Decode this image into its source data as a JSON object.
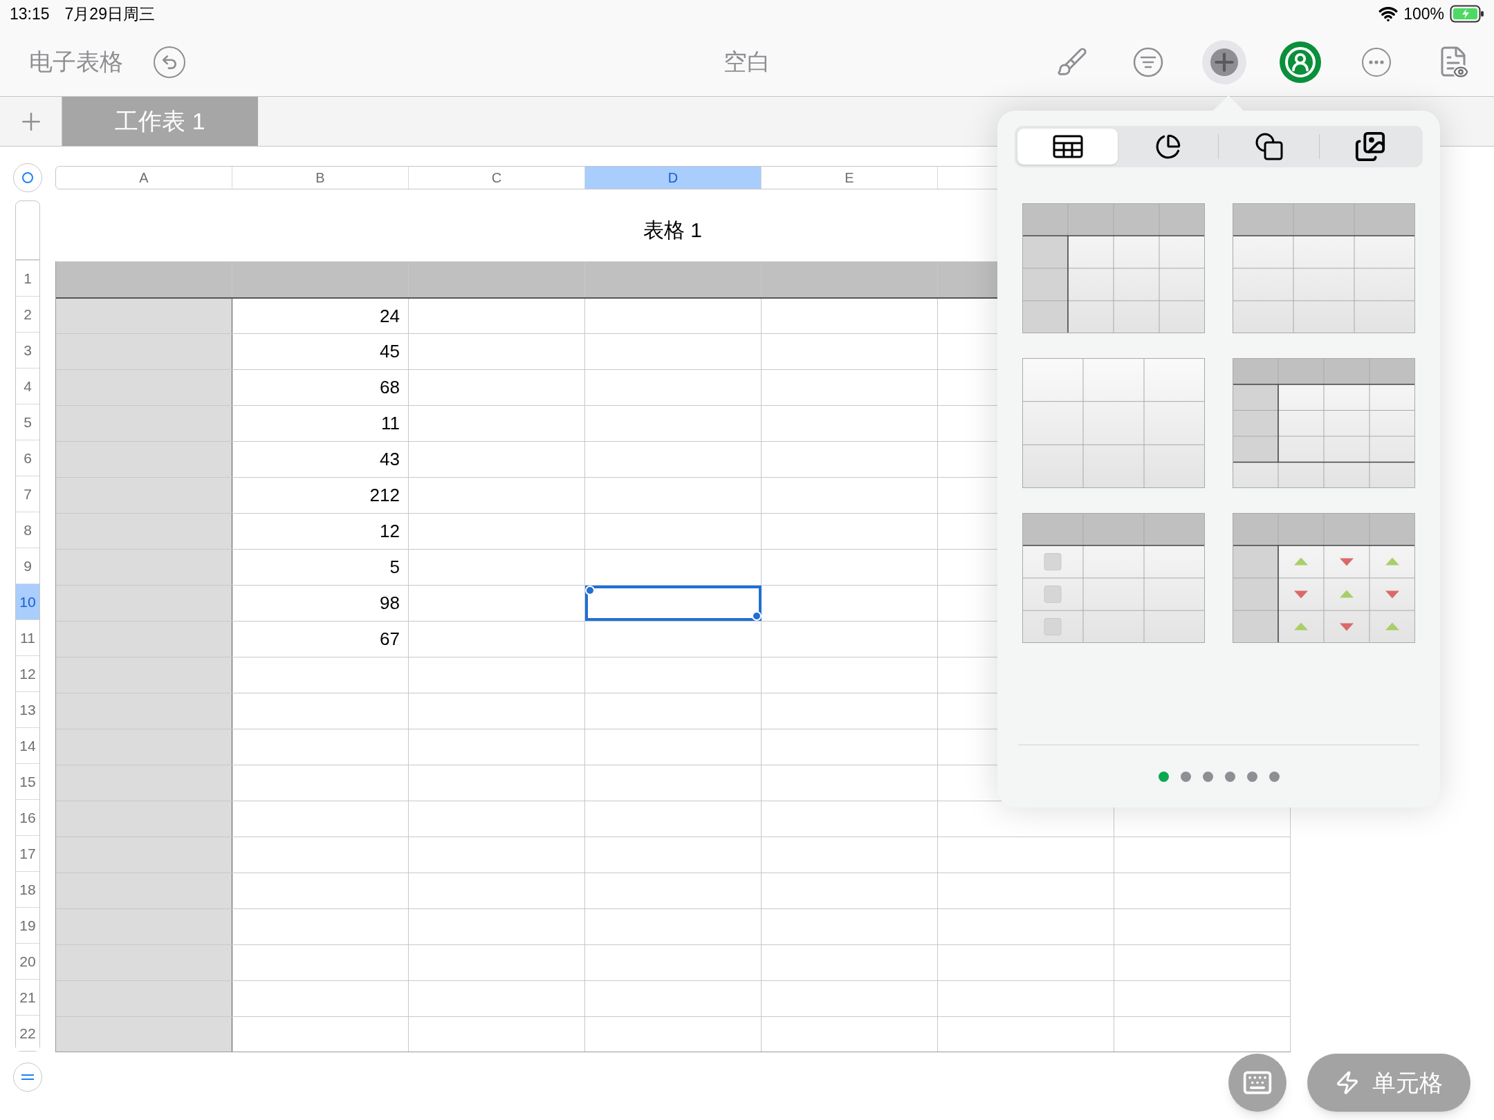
{
  "status_bar": {
    "time": "13:15",
    "date": "7月29日周三",
    "battery": "100%"
  },
  "toolbar": {
    "back_label": "电子表格",
    "title": "空白",
    "tools": [
      {
        "kind": "brush",
        "selected": false
      },
      {
        "kind": "filter",
        "selected": false
      },
      {
        "kind": "insert",
        "selected": true
      },
      {
        "kind": "collaborate",
        "selected": false
      },
      {
        "kind": "more",
        "selected": false
      },
      {
        "kind": "view",
        "selected": false
      }
    ]
  },
  "sheet_tabs": [
    {
      "label": "工作表 1",
      "selected": true
    }
  ],
  "column_headers": [
    {
      "label": "A",
      "selected": false
    },
    {
      "label": "B",
      "selected": false
    },
    {
      "label": "C",
      "selected": false
    },
    {
      "label": "D",
      "selected": true
    },
    {
      "label": "E",
      "selected": false
    }
  ],
  "table": {
    "title": "表格 1",
    "rows": [
      {
        "number": "1",
        "selected": false
      },
      {
        "number": "2",
        "selected": false,
        "column_b": "24"
      },
      {
        "number": "3",
        "selected": false,
        "column_b": "45"
      },
      {
        "number": "4",
        "selected": false,
        "column_b": "68"
      },
      {
        "number": "5",
        "selected": false,
        "column_b": "11"
      },
      {
        "number": "6",
        "selected": false,
        "column_b": "43"
      },
      {
        "number": "7",
        "selected": false,
        "column_b": "212"
      },
      {
        "number": "8",
        "selected": false,
        "column_b": "12"
      },
      {
        "number": "9",
        "selected": false,
        "column_b": "5"
      },
      {
        "number": "10",
        "selected": true,
        "column_b": "98"
      },
      {
        "number": "11",
        "selected": false,
        "column_b": "67"
      },
      {
        "number": "12",
        "selected": false
      },
      {
        "number": "13",
        "selected": false
      },
      {
        "number": "14",
        "selected": false
      },
      {
        "number": "15",
        "selected": false
      },
      {
        "number": "16",
        "selected": false
      },
      {
        "number": "17",
        "selected": false
      },
      {
        "number": "18",
        "selected": false
      },
      {
        "number": "19",
        "selected": false
      },
      {
        "number": "20",
        "selected": false
      },
      {
        "number": "21",
        "selected": false
      },
      {
        "number": "22",
        "selected": false
      }
    ]
  },
  "insert_popover": {
    "tabs": [
      {
        "kind": "table",
        "selected": true
      },
      {
        "kind": "chart",
        "selected": false
      },
      {
        "kind": "shape",
        "selected": false
      },
      {
        "kind": "media",
        "selected": false
      }
    ],
    "styles": [
      {
        "kind": "header-row-column"
      },
      {
        "kind": "header-row"
      },
      {
        "kind": "plain"
      },
      {
        "kind": "header-footer"
      },
      {
        "kind": "checkbox"
      },
      {
        "kind": "stepper"
      }
    ],
    "pages": [
      {
        "selected": true
      },
      {
        "selected": false
      },
      {
        "selected": false
      },
      {
        "selected": false
      },
      {
        "selected": false
      },
      {
        "selected": false
      }
    ]
  },
  "bottom_actions": {
    "cell_button": "单元格"
  }
}
